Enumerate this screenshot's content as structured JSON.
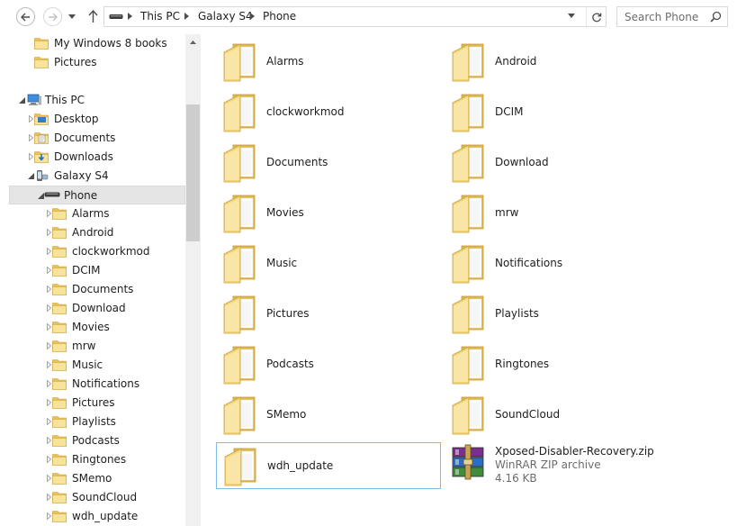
{
  "address_bar": {
    "breadcrumbs": [
      "This PC",
      "Galaxy S4",
      "Phone"
    ]
  },
  "search": {
    "placeholder": "Search Phone"
  },
  "nav_tree": {
    "quick_items": [
      {
        "label": "My Windows 8 books",
        "icon": "folder-icon"
      },
      {
        "label": "Pictures",
        "icon": "folder-icon"
      }
    ],
    "this_pc": "This PC",
    "this_pc_items": [
      {
        "label": "Desktop",
        "icon": "desktop-folder-icon"
      },
      {
        "label": "Documents",
        "icon": "documents-folder-icon"
      },
      {
        "label": "Downloads",
        "icon": "downloads-folder-icon"
      }
    ],
    "device": "Galaxy S4",
    "storage": "Phone",
    "phone_folders": [
      "Alarms",
      "Android",
      "clockworkmod",
      "DCIM",
      "Documents",
      "Download",
      "Movies",
      "mrw",
      "Music",
      "Notifications",
      "Pictures",
      "Playlists",
      "Podcasts",
      "Ringtones",
      "SMemo",
      "SoundCloud",
      "wdh_update"
    ]
  },
  "content": {
    "folders": [
      "Alarms",
      "Android",
      "clockworkmod",
      "DCIM",
      "Documents",
      "Download",
      "Movies",
      "mrw",
      "Music",
      "Notifications",
      "Pictures",
      "Playlists",
      "Podcasts",
      "Ringtones",
      "SMemo",
      "SoundCloud",
      "wdh_update"
    ],
    "selected_folder": "wdh_update",
    "zip_file": {
      "name": "Xposed-Disabler-Recovery.zip",
      "type": "WinRAR ZIP archive",
      "size": "4.16 KB"
    }
  },
  "colors": {
    "folder_light": "#f8e39a",
    "folder_dark": "#e8c257",
    "selection_border": "#7fbcea",
    "tree_selection_bg": "#e5e5e5"
  }
}
